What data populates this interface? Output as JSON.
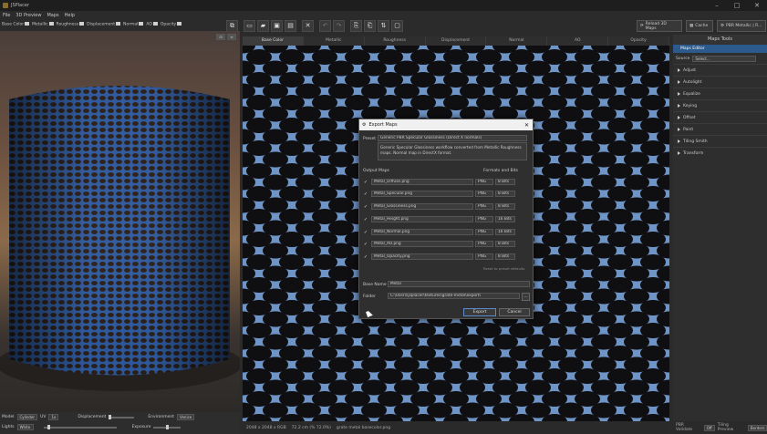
{
  "app": {
    "title": "JSPlacer"
  },
  "menu": [
    "File",
    "3D Preview",
    "Maps",
    "Help"
  ],
  "channels": [
    "Base Color",
    "Metallic",
    "Roughness",
    "Displacement",
    "Normal",
    "AO",
    "Opacity"
  ],
  "toolbar_icons": [
    "new-icon",
    "open-icon",
    "save-icon",
    "save-as-icon",
    "close-icon",
    "undo-icon",
    "redo-icon",
    "copy-icon",
    "paste-icon",
    "swap-icon",
    "comment-icon"
  ],
  "right_buttons": {
    "reload": "Reload 3D Maps",
    "cache": "Cache",
    "pbr": "PBR Metallic | R..."
  },
  "map_tabs": [
    "Base Color",
    "Metallic",
    "Roughness",
    "Displacement",
    "Normal",
    "AO",
    "Opacity"
  ],
  "active_tab": 0,
  "viewport": {
    "mesh_label": "Model",
    "mesh_value": "Cylinder",
    "uv_label": "UV",
    "uv_value": "1x",
    "displacement_label": "Displacement",
    "environment_label": "Environment",
    "environment_value": "Venice",
    "lights_label": "Lights",
    "lights_value": "White",
    "exposure_label": "Exposure"
  },
  "texture_status": {
    "size": "2048 x 2048 x RGB",
    "zoom": "72.2 cm (% 72.0%)",
    "file": "grate metal basecolor.png"
  },
  "right_panel": {
    "title": "Maps Tools",
    "subheader": "Maps Editor",
    "source_label": "Source",
    "source_value": "Select...",
    "sections": [
      "Adjust",
      "Autolight",
      "Equalize",
      "Keying",
      "Offset",
      "Paint",
      "Tiling Smith",
      "Transform"
    ]
  },
  "bottom_right": {
    "pbr_label": "PBR Validate",
    "pbr_value": "Off",
    "tiling_label": "Tiling Preview",
    "tiling_value": "Borders"
  },
  "dialog": {
    "title": "Export Maps",
    "preset_label": "Preset",
    "preset_value": "Generic PBR Specular Glossiness (Direct X normals)",
    "description": "Generic Specular Glossiness workflow converted from Metallic Roughness maps. Normal map in DirectX format.",
    "output_label": "Output Maps",
    "formats_label": "Formats and Bits",
    "maps": [
      {
        "file": "Metal_Diffuse.png",
        "format": "PNG",
        "bits": "8 Bits"
      },
      {
        "file": "Metal_Specular.png",
        "format": "PNG",
        "bits": "8 Bits"
      },
      {
        "file": "Metal_Glossiness.png",
        "format": "PNG",
        "bits": "8 Bits"
      },
      {
        "file": "Metal_Height.png",
        "format": "PNG",
        "bits": "16 Bits"
      },
      {
        "file": "Metal_Normal.png",
        "format": "PNG",
        "bits": "16 Bits"
      },
      {
        "file": "Metal_AO.png",
        "format": "PNG",
        "bits": "8 Bits"
      },
      {
        "file": "Metal_Opacity.png",
        "format": "PNG",
        "bits": "8 Bits"
      }
    ],
    "reset_link": "Reset to preset defaults",
    "base_name_label": "Base Name",
    "base_name_value": "Metal",
    "folder_label": "Folder",
    "folder_value": "C:\\Users\\jsplacer\\textures\\grate-metal\\export\\",
    "browse": "...",
    "export_btn": "Export",
    "cancel_btn": "Cancel"
  },
  "colors": {
    "accent": "#2c5a8c",
    "metal": "#5a80b8"
  }
}
